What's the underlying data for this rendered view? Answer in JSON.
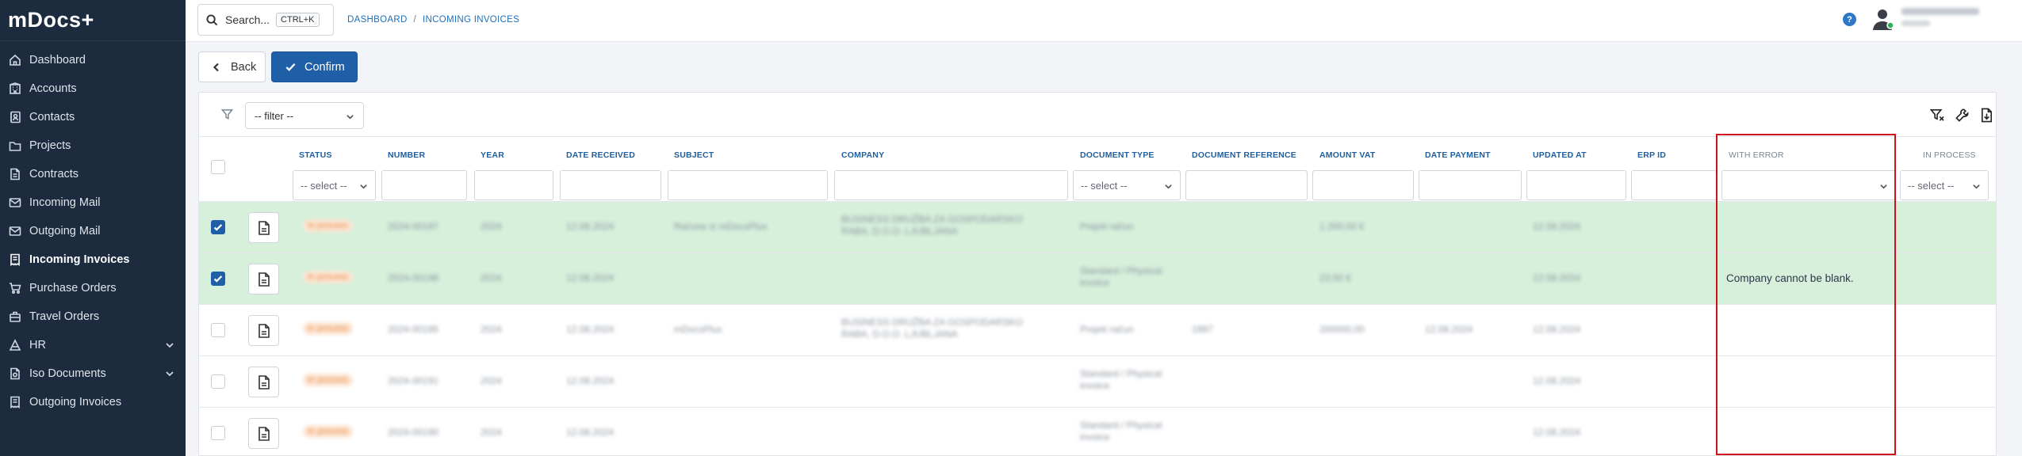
{
  "app": {
    "logo": "mDocs+"
  },
  "sidebar": {
    "items": [
      {
        "label": "Dashboard",
        "icon": "home-icon",
        "active": false,
        "expandable": false
      },
      {
        "label": "Accounts",
        "icon": "building-icon",
        "active": false,
        "expandable": false
      },
      {
        "label": "Contacts",
        "icon": "contacts-icon",
        "active": false,
        "expandable": false
      },
      {
        "label": "Projects",
        "icon": "projects-icon",
        "active": false,
        "expandable": false
      },
      {
        "label": "Contracts",
        "icon": "contracts-icon",
        "active": false,
        "expandable": false
      },
      {
        "label": "Incoming Mail",
        "icon": "mail-icon",
        "active": false,
        "expandable": false
      },
      {
        "label": "Outgoing Mail",
        "icon": "mail-icon",
        "active": false,
        "expandable": false
      },
      {
        "label": "Incoming Invoices",
        "icon": "invoice-icon",
        "active": true,
        "expandable": false
      },
      {
        "label": "Purchase Orders",
        "icon": "cart-icon",
        "active": false,
        "expandable": false
      },
      {
        "label": "Travel Orders",
        "icon": "travel-icon",
        "active": false,
        "expandable": false
      },
      {
        "label": "HR",
        "icon": "hr-icon",
        "active": false,
        "expandable": true
      },
      {
        "label": "Iso Documents",
        "icon": "iso-icon",
        "active": false,
        "expandable": true
      },
      {
        "label": "Outgoing Invoices",
        "icon": "invoice-out-icon",
        "active": false,
        "expandable": false
      }
    ]
  },
  "topbar": {
    "search_label": "Search...",
    "search_shortcut": "CTRL+K",
    "breadcrumb": [
      "DASHBOARD",
      "INCOMING INVOICES"
    ],
    "breadcrumb_sep": "/",
    "help": "?"
  },
  "actions": {
    "back_label": "Back",
    "confirm_label": "Confirm"
  },
  "filter": {
    "placeholder": "-- filter --"
  },
  "table": {
    "columns": {
      "status": "STATUS",
      "number": "NUMBER",
      "year": "YEAR",
      "date_received": "DATE RECEIVED",
      "subject": "SUBJECT",
      "company": "COMPANY",
      "document_type": "DOCUMENT TYPE",
      "document_reference": "DOCUMENT REFERENCE",
      "amount_vat": "AMOUNT VAT",
      "date_payment": "DATE PAYMENT",
      "updated_at": "UPDATED AT",
      "erp_id": "ERP ID",
      "with_error": "WITH ERROR",
      "in_process": "IN PROCESS"
    },
    "select_placeholder": "-- select --",
    "rows": [
      {
        "selected": true,
        "status": "In process",
        "number": "2024-00197",
        "year": "2024",
        "date_received": "12.08.2024",
        "subject": "Račune iz mDocsPlus",
        "company": "BUSINESS DRUŽBA ZA GOSPODARSKO",
        "company2": "RABA, D.O.O. LJUBLJANA",
        "document_type": "Prejeti račun",
        "document_type2": "",
        "document_reference": "",
        "amount_vat": "1.200,00 €",
        "date_payment": "",
        "updated_at": "12.08.2024",
        "with_error": ""
      },
      {
        "selected": true,
        "status": "In process",
        "number": "2024-00198",
        "year": "2024",
        "date_received": "12.08.2024",
        "subject": "",
        "company": "",
        "company2": "",
        "document_type": "Standard / Physical",
        "document_type2": "invoice",
        "document_reference": "",
        "amount_vat": "23,50 €",
        "date_payment": "",
        "updated_at": "12.08.2024",
        "with_error": "Company cannot be blank."
      },
      {
        "selected": false,
        "status": "In process",
        "number": "2024-00195",
        "year": "2024",
        "date_received": "12.08.2024",
        "subject": "mDocsPlus",
        "company": "BUSINESS DRUŽBA ZA GOSPODARSKO",
        "company2": "RABA, D.O.O. LJUBLJANA",
        "document_type": "Prejeti račun",
        "document_type2": "",
        "document_reference": "1987",
        "amount_vat": "200000,00",
        "date_payment": "12.08.2024",
        "updated_at": "12.08.2024",
        "with_error": ""
      },
      {
        "selected": false,
        "status": "In process",
        "number": "2024-00191",
        "year": "2024",
        "date_received": "12.08.2024",
        "subject": "",
        "company": "",
        "company2": "",
        "document_type": "Standard / Physical",
        "document_type2": "invoice",
        "document_reference": "",
        "amount_vat": "",
        "date_payment": "",
        "updated_at": "12.08.2024",
        "with_error": ""
      },
      {
        "selected": false,
        "status": "In process",
        "number": "2024-00190",
        "year": "2024",
        "date_received": "12.08.2024",
        "subject": "",
        "company": "",
        "company2": "",
        "document_type": "Standard / Physical",
        "document_type2": "invoice",
        "document_reference": "",
        "amount_vat": "",
        "date_payment": "",
        "updated_at": "12.08.2024",
        "with_error": ""
      }
    ]
  },
  "colors": {
    "sidebar_bg": "#1c2b3e",
    "primary": "#1f5fa8",
    "selected_row": "#d6f0dc",
    "highlight": "#d0111b"
  }
}
